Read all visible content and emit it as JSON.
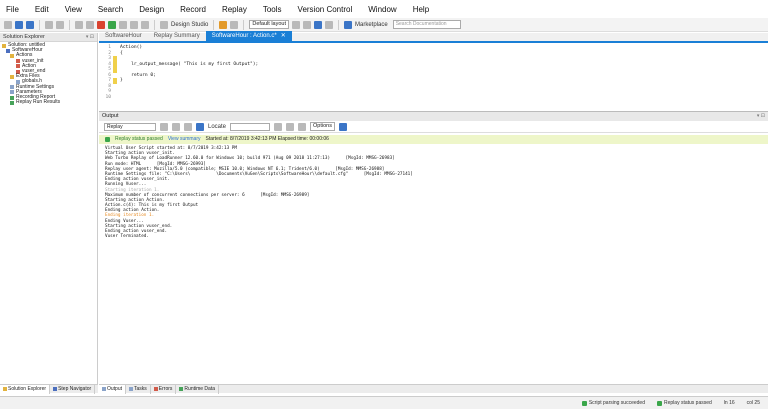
{
  "menu": [
    "File",
    "Edit",
    "View",
    "Search",
    "Design",
    "Record",
    "Replay",
    "Tools",
    "Version Control",
    "Window",
    "Help"
  ],
  "toolbar": {
    "design_studio_label": "Design Studio",
    "layout_value": "Default layout",
    "marketplace_label": "Marketplace",
    "search_placeholder": "Search Documentation"
  },
  "solution_explorer": {
    "title": "Solution Explorer",
    "items": [
      {
        "label": "Solution: untitled",
        "icon": "solution-icon"
      },
      {
        "label": "SoftwareHour",
        "icon": "script-icon"
      },
      {
        "label": "Actions",
        "icon": "folder-icon"
      },
      {
        "label": "vuser_init",
        "icon": "action-icon"
      },
      {
        "label": "Action",
        "icon": "action-icon"
      },
      {
        "label": "vuser_end",
        "icon": "action-icon"
      },
      {
        "label": "Extra Files",
        "icon": "folder-icon"
      },
      {
        "label": "globals.h",
        "icon": "file-icon"
      },
      {
        "label": "Runtime Settings",
        "icon": "settings-icon"
      },
      {
        "label": "Parameters",
        "icon": "parameters-icon"
      },
      {
        "label": "Recording Report",
        "icon": "report-icon"
      },
      {
        "label": "Replay Run Results",
        "icon": "results-icon"
      }
    ],
    "tabs": [
      "Solution Explorer",
      "Step Navigator"
    ]
  },
  "editor": {
    "tabs": [
      "SoftwareHour",
      "Replay Summary",
      "SoftwareHour : Action.c*"
    ],
    "lines": [
      {
        "num": "1",
        "text": "Action()",
        "mark": false
      },
      {
        "num": "2",
        "text": "{",
        "mark": false
      },
      {
        "num": "3",
        "text": "",
        "mark": true
      },
      {
        "num": "4",
        "text": "    lr_output_message( \"This is my first Output\");",
        "mark": true
      },
      {
        "num": "5",
        "text": "",
        "mark": true
      },
      {
        "num": "6",
        "text": "    return 0;",
        "mark": false
      },
      {
        "num": "7",
        "text": "}",
        "mark": true
      },
      {
        "num": "8",
        "text": "",
        "mark": false
      },
      {
        "num": "9",
        "text": "",
        "mark": false
      },
      {
        "num": "10",
        "text": "",
        "mark": false
      }
    ]
  },
  "output": {
    "title": "Output",
    "filter_value": "Replay",
    "locate_label": "Locate",
    "options_label": "Options",
    "status_text": "Replay status passed",
    "view_summary": "View summary",
    "started_text": "Started at: 8/7/2019 3:42:13 PM Elapsed time: 00:00:06",
    "log": [
      {
        "text": "Virtual User Script started at: 8/7/2019 3:42:13 PM",
        "style": ""
      },
      {
        "text": "Starting action vuser_init.",
        "style": ""
      },
      {
        "text": "Web Turbo Replay of LoadRunner 12.60.0 for Windows 10; build 971 (Aug 09 2018 11:27:13)      [MsgId: MMSG-26983]",
        "style": ""
      },
      {
        "text": "Run mode: HTML      [MsgId: MMSG-26993]",
        "style": ""
      },
      {
        "text": "Replay user agent: Mozilla/5.0 (compatible; MSIE 10.0; Windows NT 6.1; Trident/6.0)      [MsgId: MMSG-26988]",
        "style": ""
      },
      {
        "text": "Runtime Settings file: \"C:\\Users\\          \\Documents\\VuGen\\Scripts\\SoftwareHour\\\\default.cfg\"      [MsgId: MMSG-27141]",
        "style": ""
      },
      {
        "text": "Ending action vuser_init.",
        "style": ""
      },
      {
        "text": "Running Vuser...",
        "style": ""
      },
      {
        "text": "Starting iteration 1.",
        "style": "grey"
      },
      {
        "text": "Maximum number of concurrent connections per server: 6      [MsgId: MMSG-26989]",
        "style": ""
      },
      {
        "text": "Starting action Action.",
        "style": ""
      },
      {
        "text": "Action.c(4): This is my first Output",
        "style": ""
      },
      {
        "text": "Ending action Action.",
        "style": ""
      },
      {
        "text": "Ending iteration 1.",
        "style": "orange"
      },
      {
        "text": "Ending Vuser...",
        "style": ""
      },
      {
        "text": "Starting action vuser_end.",
        "style": ""
      },
      {
        "text": "Ending action vuser_end.",
        "style": ""
      },
      {
        "text": "Vuser Terminated.",
        "style": ""
      }
    ],
    "tabs": [
      "Output",
      "Tasks",
      "Errors",
      "Runtime Data"
    ]
  },
  "statusbar": {
    "script_parsing": "Script parsing succeeded",
    "replay_status": "Replay status passed",
    "ln": "ln 16",
    "col": "col 25"
  }
}
